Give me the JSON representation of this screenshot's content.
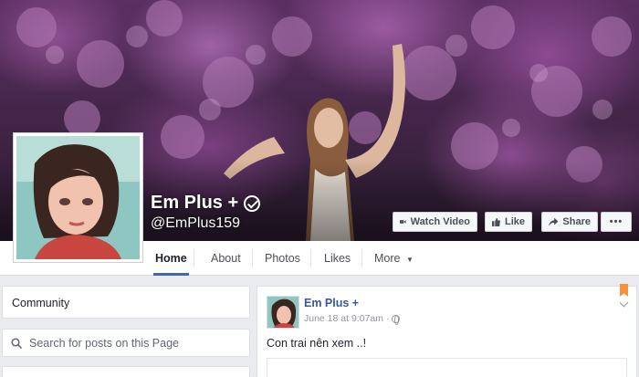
{
  "page": {
    "name": "Em Plus +",
    "handle": "@EmPlus159"
  },
  "cover_actions": {
    "watch_video": "Watch Video",
    "like": "Like",
    "share": "Share",
    "more": "•••"
  },
  "nav": {
    "tabs": [
      {
        "label": "Home",
        "active": true
      },
      {
        "label": "About"
      },
      {
        "label": "Photos"
      },
      {
        "label": "Likes"
      },
      {
        "label": "More"
      }
    ]
  },
  "sidebar": {
    "community_title": "Community",
    "search_placeholder": "Search for posts on this Page"
  },
  "post": {
    "author": "Em Plus +",
    "timestamp": "June 18 at 9:07am",
    "text": "Con trai nên xem ..!"
  },
  "colors": {
    "link": "#365899",
    "active_tab_underline": "#4267b2",
    "bookmark": "#f7923a"
  },
  "icons": [
    "verified-icon",
    "video-icon",
    "thumbs-up-icon",
    "share-arrow-icon",
    "search-icon",
    "globe-icon",
    "bookmark-icon",
    "chevron-down-icon"
  ]
}
